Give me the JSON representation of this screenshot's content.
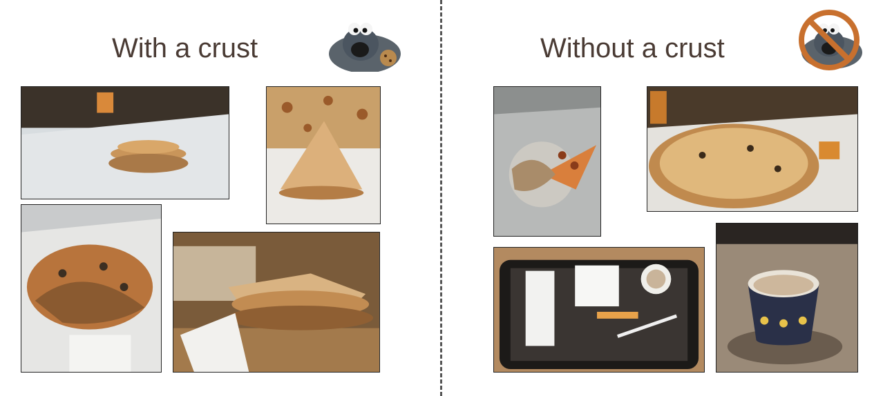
{
  "left": {
    "heading": "With a crust",
    "badge_icon": "cookie-monster-icon",
    "photos": [
      "pizza-slices-stacked-photo",
      "pizza-wedge-closeup-photo",
      "pizza-folded-box-photo",
      "pizza-layered-slice-photo"
    ]
  },
  "right": {
    "heading": "Without a crust",
    "badge_icon": "cookie-monster-prohibited-icon",
    "photos": [
      "pizza-slice-box-photo",
      "whole-pizza-box-photo",
      "tray-receipt-coffee-photo",
      "coffee-cup-table-photo"
    ]
  },
  "colors": {
    "heading": "#4a3b34",
    "prohibit_ring": "#c8702e",
    "monster_fur": "#4b5560"
  }
}
